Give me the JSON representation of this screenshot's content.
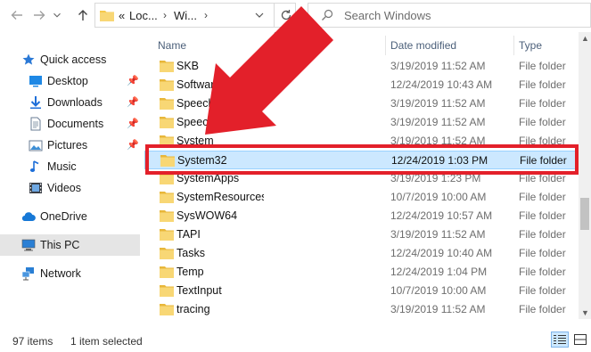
{
  "address": {
    "crumbs": [
      "«",
      "Loc...",
      "Wi..."
    ],
    "separators": [
      "›",
      "›"
    ]
  },
  "search": {
    "placeholder": "Search Windows"
  },
  "nav": {
    "items": [
      {
        "label": "Quick access",
        "icon": "star-icon",
        "pinned": false
      },
      {
        "label": "Desktop",
        "icon": "desktop-icon",
        "pinned": true
      },
      {
        "label": "Downloads",
        "icon": "download-icon",
        "pinned": true
      },
      {
        "label": "Documents",
        "icon": "documents-icon",
        "pinned": true
      },
      {
        "label": "Pictures",
        "icon": "pictures-icon",
        "pinned": true
      },
      {
        "label": "Music",
        "icon": "music-icon",
        "pinned": false
      },
      {
        "label": "Videos",
        "icon": "videos-icon",
        "pinned": false
      },
      {
        "label": "OneDrive",
        "icon": "cloud-icon",
        "pinned": false
      },
      {
        "label": "This PC",
        "icon": "computer-icon",
        "pinned": false,
        "selected": true
      },
      {
        "label": "Network",
        "icon": "network-icon",
        "pinned": false
      }
    ]
  },
  "list": {
    "headers": {
      "name": "Name",
      "date": "Date modified",
      "type": "Type"
    },
    "rows": [
      {
        "name": "SKB",
        "date": "3/19/2019 11:52 AM",
        "type": "File folder"
      },
      {
        "name": "SoftwareDistribution",
        "date": "12/24/2019 10:43 AM",
        "type": "File folder"
      },
      {
        "name": "Speech",
        "date": "3/19/2019 11:52 AM",
        "type": "File folder"
      },
      {
        "name": "Speech_OneCore",
        "date": "3/19/2019 11:52 AM",
        "type": "File folder"
      },
      {
        "name": "System",
        "date": "3/19/2019 11:52 AM",
        "type": "File folder"
      },
      {
        "name": "System32",
        "date": "12/24/2019 1:03 PM",
        "type": "File folder",
        "selected": true
      },
      {
        "name": "SystemApps",
        "date": "3/19/2019 1:23 PM",
        "type": "File folder"
      },
      {
        "name": "SystemResources",
        "date": "10/7/2019 10:00 AM",
        "type": "File folder"
      },
      {
        "name": "SysWOW64",
        "date": "12/24/2019 10:57 AM",
        "type": "File folder"
      },
      {
        "name": "TAPI",
        "date": "3/19/2019 11:52 AM",
        "type": "File folder"
      },
      {
        "name": "Tasks",
        "date": "12/24/2019 10:40 AM",
        "type": "File folder"
      },
      {
        "name": "Temp",
        "date": "12/24/2019 1:04 PM",
        "type": "File folder"
      },
      {
        "name": "TextInput",
        "date": "10/7/2019 10:00 AM",
        "type": "File folder"
      },
      {
        "name": "tracing",
        "date": "3/19/2019 11:52 AM",
        "type": "File folder"
      }
    ]
  },
  "status": {
    "count": "97 items",
    "selection": "1 item selected"
  },
  "colors": {
    "annotation_red": "#e3202a",
    "selection_bg": "#cce8ff",
    "selection_border": "#99d1ff",
    "folder_yellow": "#f6c94c"
  }
}
